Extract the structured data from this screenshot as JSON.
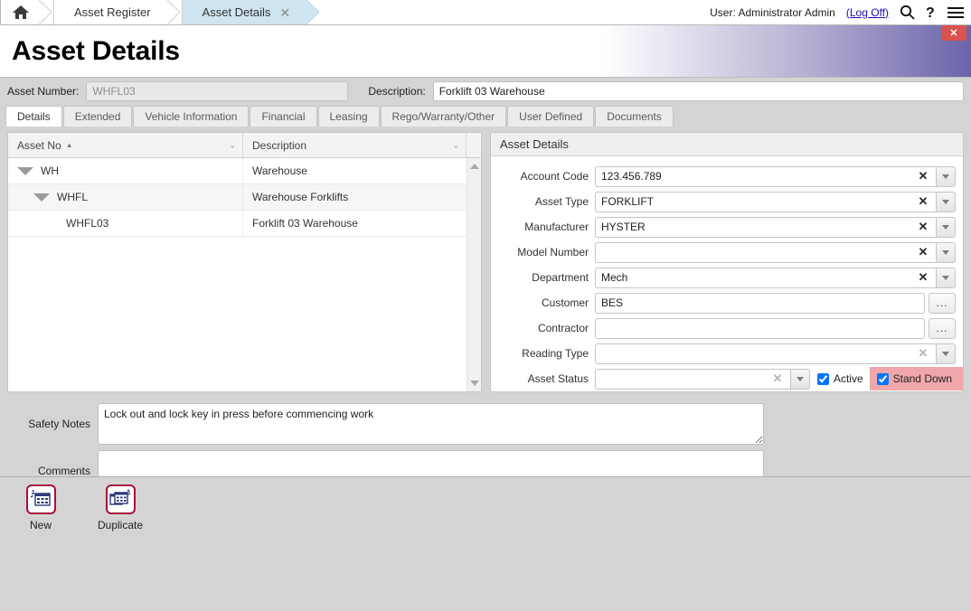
{
  "topbar": {
    "home_icon": "home-icon",
    "breadcrumbs": [
      {
        "label": "Asset Register",
        "active": false,
        "closable": false
      },
      {
        "label": "Asset Details",
        "active": true,
        "closable": true
      }
    ],
    "close_glyph": "✕",
    "user_text": "User: Administrator Admin",
    "logoff_label": "(Log Off)",
    "search_icon": "search-icon",
    "help_icon": "help-icon",
    "menu_icon": "hamburger-menu-icon"
  },
  "header": {
    "title": "Asset Details",
    "close_label": "✕",
    "accent_color": "#6b64ab",
    "close_color": "#d9534f"
  },
  "idbar": {
    "asset_number_label": "Asset Number:",
    "asset_number_value": "WHFL03",
    "description_label": "Description:",
    "description_value": "Forklift 03 Warehouse"
  },
  "tabs": [
    {
      "label": "Details",
      "active": true
    },
    {
      "label": "Extended",
      "active": false
    },
    {
      "label": "Vehicle Information",
      "active": false
    },
    {
      "label": "Financial",
      "active": false
    },
    {
      "label": "Leasing",
      "active": false
    },
    {
      "label": "Rego/Warranty/Other",
      "active": false
    },
    {
      "label": "User Defined",
      "active": false
    },
    {
      "label": "Documents",
      "active": false
    }
  ],
  "grid": {
    "columns": [
      {
        "label": "Asset No",
        "sort": "▲"
      },
      {
        "label": "Description",
        "sort": ""
      }
    ],
    "filter_glyph": "⌄",
    "rows": [
      {
        "code": "WH",
        "description": "Warehouse",
        "indent": 1,
        "expanded": true
      },
      {
        "code": "WHFL",
        "description": "Warehouse Forklifts",
        "indent": 2,
        "expanded": true
      },
      {
        "code": "WHFL03",
        "description": "Forklift 03 Warehouse",
        "indent": 3,
        "expanded": false
      }
    ]
  },
  "details": {
    "panel_title": "Asset Details",
    "fields": [
      {
        "label": "Account Code",
        "value": "123.456.789",
        "control": "clear-drop",
        "dim": false
      },
      {
        "label": "Asset Type",
        "value": "FORKLIFT",
        "control": "clear-drop",
        "dim": false
      },
      {
        "label": "Manufacturer",
        "value": "HYSTER",
        "control": "clear-drop",
        "dim": false
      },
      {
        "label": "Model Number",
        "value": "",
        "control": "clear-drop",
        "dim": false
      },
      {
        "label": "Department",
        "value": "Mech",
        "control": "clear-drop",
        "dim": false
      },
      {
        "label": "Customer",
        "value": "BES",
        "control": "ellipsis",
        "dim": false
      },
      {
        "label": "Contractor",
        "value": "",
        "control": "ellipsis",
        "dim": false
      },
      {
        "label": "Reading Type",
        "value": "",
        "control": "clear-drop",
        "dim": true
      }
    ],
    "clear_glyph": "✕",
    "ellipsis_glyph": "...",
    "status": {
      "label": "Asset Status",
      "value": "",
      "active_label": "Active",
      "active_checked": true,
      "standdown_label": "Stand Down",
      "standdown_checked": true,
      "standdown_bg": "#f0a7ab"
    }
  },
  "notes": {
    "safety_label": "Safety Notes",
    "safety_value": "Lock out and lock key in press before commencing work",
    "comments_label": "Comments",
    "comments_value": ""
  },
  "footer": {
    "buttons": [
      {
        "label": "New",
        "icon": "new-record-icon"
      },
      {
        "label": "Duplicate",
        "icon": "duplicate-record-icon"
      }
    ],
    "icon_border_color": "#ab0f3c"
  }
}
